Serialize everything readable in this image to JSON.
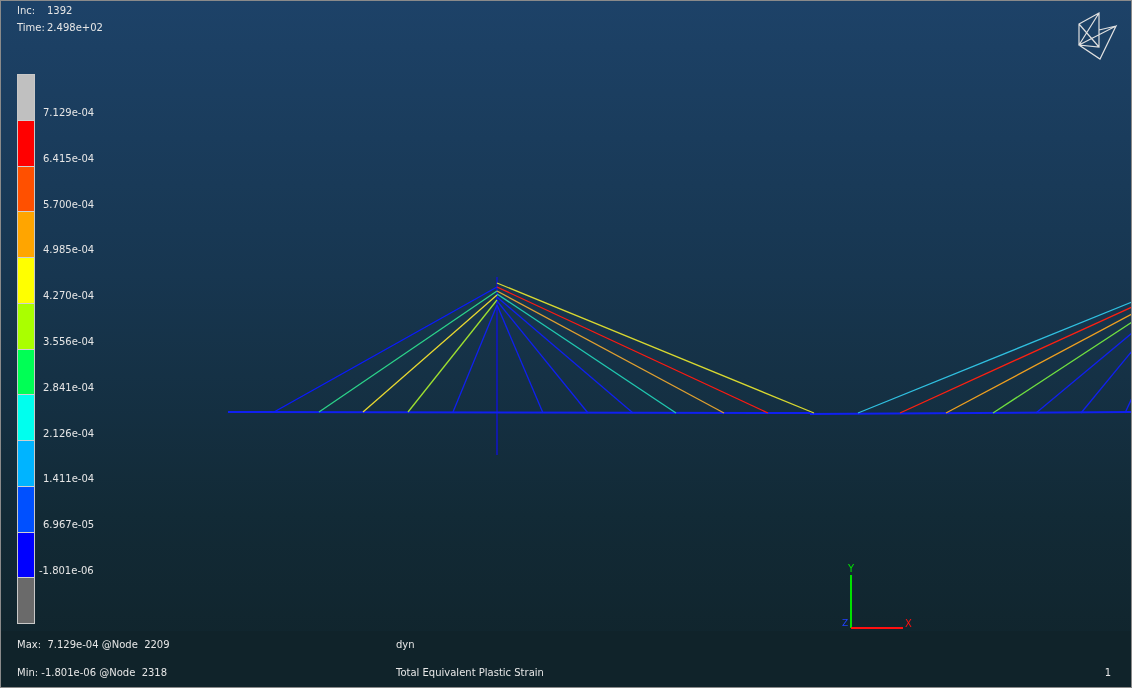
{
  "info": {
    "increment_label": "Inc:",
    "increment": "1392",
    "time_label": "Time:",
    "time": "2.498e+02"
  },
  "legend": {
    "bands": [
      {
        "color": "#c0c0c0"
      },
      {
        "color": "#ff0000"
      },
      {
        "color": "#ff5000"
      },
      {
        "color": "#ffa500"
      },
      {
        "color": "#ffff00"
      },
      {
        "color": "#aaff00"
      },
      {
        "color": "#00ff55"
      },
      {
        "color": "#00ffee"
      },
      {
        "color": "#00b4ff"
      },
      {
        "color": "#0050ff"
      },
      {
        "color": "#0000ff"
      },
      {
        "color": "#6a6a6a"
      }
    ],
    "labels": [
      "7.129e-04",
      "6.415e-04",
      "5.700e-04",
      "4.985e-04",
      "4.270e-04",
      "3.556e-04",
      "2.841e-04",
      "2.126e-04",
      "1.411e-04",
      "6.967e-05",
      "-1.801e-06"
    ]
  },
  "axes": {
    "y": "Y",
    "x": "X",
    "z": "Z"
  },
  "footer": {
    "max": "Max:  7.129e-04 @Node  2209",
    "min": "Min: -1.801e-06 @Node  2318",
    "job": "dyn",
    "variable": "Total Equivalent Plastic Strain",
    "page": "1"
  }
}
